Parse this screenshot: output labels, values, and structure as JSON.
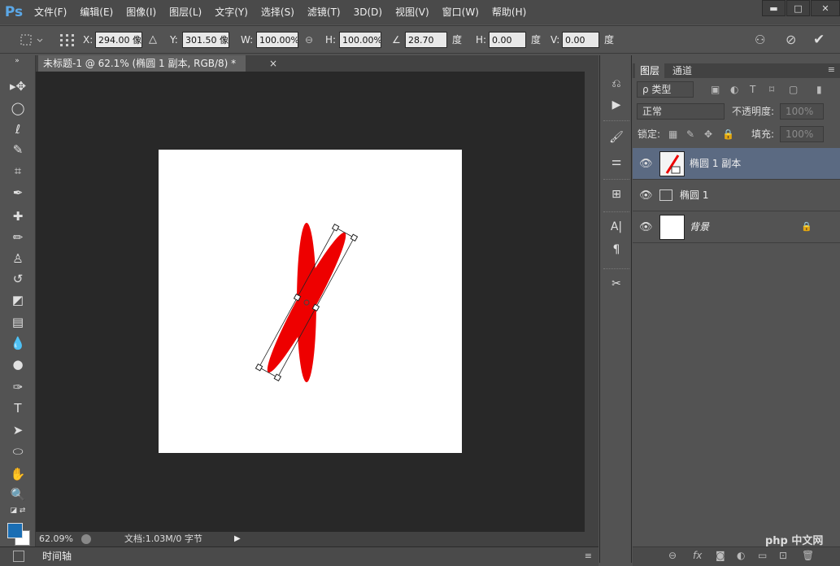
{
  "app": {
    "logo": "Ps"
  },
  "menu": [
    "文件(F)",
    "编辑(E)",
    "图像(I)",
    "图层(L)",
    "文字(Y)",
    "选择(S)",
    "滤镜(T)",
    "3D(D)",
    "视图(V)",
    "窗口(W)",
    "帮助(H)"
  ],
  "window_controls": {
    "minimize": "▬",
    "maximize": "□",
    "close": "✕"
  },
  "options": {
    "x_label": "X:",
    "x_value": "294.00 像",
    "y_label": "Y:",
    "y_value": "301.50 像",
    "w_label": "W:",
    "w_value": "100.00%",
    "h_label": "H:",
    "h_value": "100.00%",
    "angle_value": "28.70",
    "angle_unit": "度",
    "hskew_label": "H:",
    "hskew_value": "0.00",
    "hskew_unit": "度",
    "vskew_label": "V:",
    "vskew_value": "0.00",
    "vskew_unit": "度"
  },
  "document": {
    "tab_title": "未标题-1 @ 62.1% (椭圆 1 副本, RGB/8) *",
    "tab_close": "×"
  },
  "status": {
    "zoom": "62.09%",
    "doc_size": "文档:1.03M/0 字节"
  },
  "timeline": {
    "label": "时间轴"
  },
  "layers_panel": {
    "tabs": [
      "图层",
      "通道"
    ],
    "filter_kind": "ρ 类型",
    "blend_mode": "正常",
    "opacity_label": "不透明度:",
    "opacity_value": "100%",
    "lock_label": "锁定:",
    "fill_label": "填充:",
    "fill_value": "100%",
    "layers": [
      {
        "name": "椭圆 1 副本",
        "selected": true
      },
      {
        "name": "椭圆 1",
        "selected": false
      },
      {
        "name": "背景",
        "selected": false,
        "locked": true
      }
    ]
  },
  "watermark": "php 中文网",
  "colors": {
    "foreground": "#1a6eb4",
    "background": "#ffffff",
    "shape_fill": "#ee0000",
    "selection": "#5b6a82"
  }
}
